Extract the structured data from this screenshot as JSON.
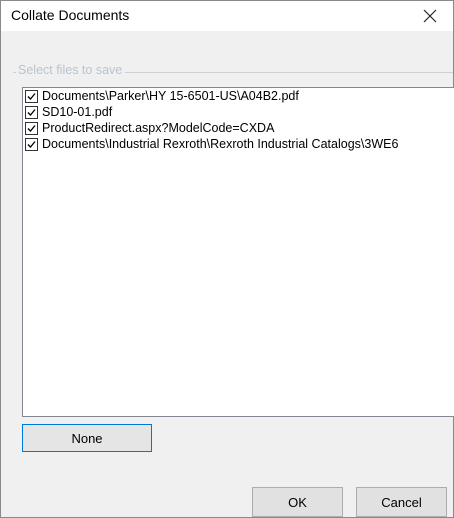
{
  "window": {
    "title": "Collate Documents",
    "close_glyph": "✕"
  },
  "group": {
    "label": "Select files to save"
  },
  "files": [
    {
      "label": "Documents\\Parker\\HY 15-6501-US\\A04B2.pdf",
      "checked": true
    },
    {
      "label": "SD10-01.pdf",
      "checked": true
    },
    {
      "label": "ProductRedirect.aspx?ModelCode=CXDA",
      "checked": true
    },
    {
      "label": "Documents\\Industrial Rexroth\\Rexroth Industrial Catalogs\\3WE6",
      "checked": true
    }
  ],
  "buttons": {
    "none_label": "None",
    "ok_label": "OK",
    "cancel_label": "Cancel"
  },
  "colors": {
    "focus_border": "#0078d7",
    "group_label": "#b8c4cf"
  }
}
